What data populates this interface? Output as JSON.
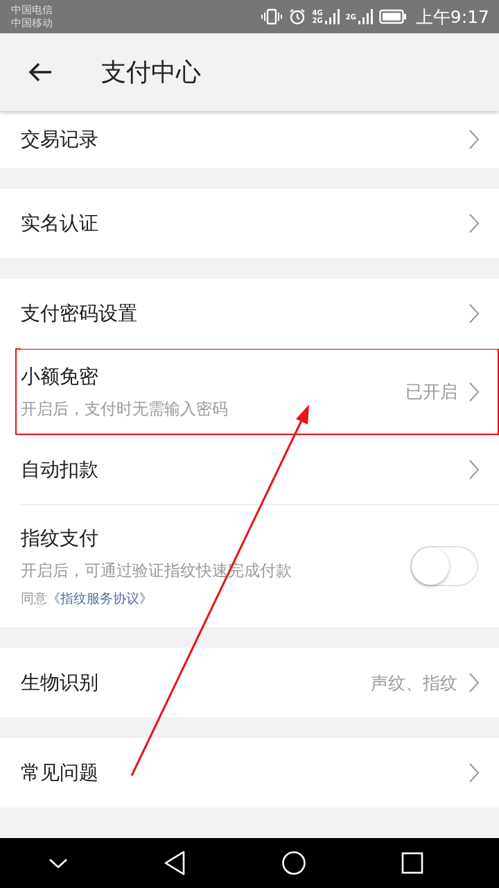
{
  "status_bar": {
    "carriers": [
      "中国电信",
      "中国移动"
    ],
    "network_labels": [
      [
        "4G",
        "2G"
      ],
      [
        "2G"
      ]
    ],
    "time": "上午9:17"
  },
  "header": {
    "title": "支付中心"
  },
  "groups": [
    {
      "items": [
        {
          "kind": "link",
          "title": "交易记录",
          "annotated": false
        }
      ]
    },
    {
      "items": [
        {
          "kind": "link",
          "title": "实名认证",
          "annotated": false
        }
      ]
    },
    {
      "items": [
        {
          "kind": "link",
          "title": "支付密码设置",
          "annotated": false
        },
        {
          "kind": "link",
          "title": "小额免密",
          "subtitle": "开启后，支付时无需输入密码",
          "value": "已开启",
          "annotated": true
        },
        {
          "kind": "link",
          "title": "自动扣款",
          "annotated": false
        },
        {
          "kind": "toggle",
          "title": "指纹支付",
          "subtitle": "开启后，可通过验证指纹快速完成付款",
          "agreement_prefix": "同意",
          "agreement_link": "《指纹服务协议》",
          "on": false,
          "annotated": false
        }
      ]
    },
    {
      "items": [
        {
          "kind": "link",
          "title": "生物识别",
          "value": "声纹、指纹",
          "annotated": false
        }
      ]
    },
    {
      "items": [
        {
          "kind": "link",
          "title": "常见问题",
          "annotated": false
        }
      ]
    }
  ],
  "annotation": {
    "arrow": true
  }
}
